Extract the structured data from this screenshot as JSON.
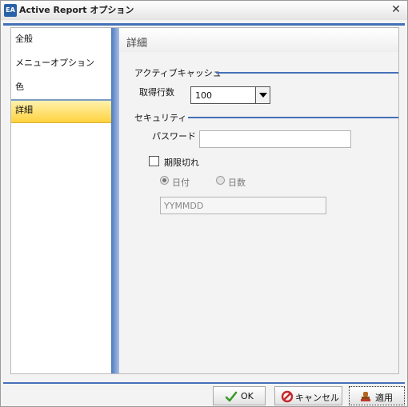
{
  "window": {
    "title": "Active Report オプション",
    "logo_text": "EA"
  },
  "nav": {
    "items": [
      {
        "label": "全般"
      },
      {
        "label": "メニューオプション"
      },
      {
        "label": "色"
      },
      {
        "label": "詳細",
        "selected": true
      }
    ]
  },
  "pane": {
    "title": "詳細",
    "active_cache": {
      "group_label": "アクティブキャッシュ",
      "rows_label": "取得行数",
      "rows_value": "100"
    },
    "security": {
      "group_label": "セキュリティ",
      "password_label": "パスワード",
      "password_value": "",
      "expire_label": "期限切れ",
      "expire_checked": false,
      "radio_date_label": "日付",
      "radio_days_label": "日数",
      "selected_radio": "日付",
      "date_placeholder": "YYMMDD"
    }
  },
  "footer": {
    "ok_label": "OK",
    "cancel_label": "キャンセル",
    "apply_label": "適用"
  },
  "colors": {
    "accent_blue": "#4470b7",
    "selected_nav": "#ffd23f"
  }
}
